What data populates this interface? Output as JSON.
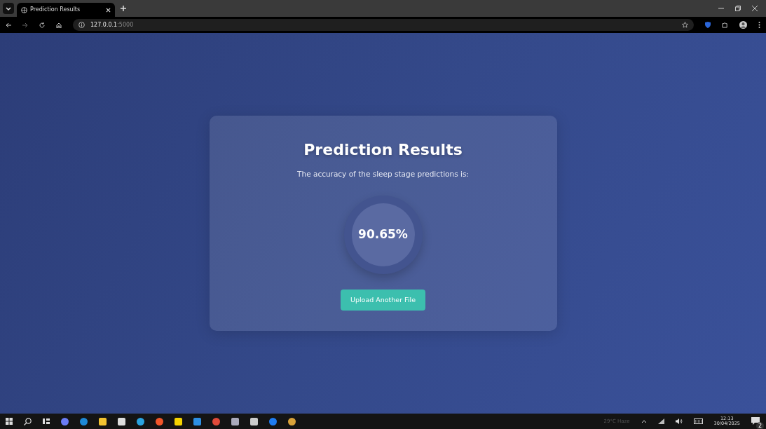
{
  "browser": {
    "tab_title": "Prediction Results",
    "address": {
      "host": "127.0.0.1",
      "port": ":5000"
    }
  },
  "card": {
    "title": "Prediction Results",
    "subtitle": "The accuracy of the sleep stage predictions is:",
    "accuracy": "90.65%",
    "button": "Upload Another File"
  },
  "taskbar": {
    "weather": "29°C Haze",
    "time": "12:13",
    "date": "30/04/2025",
    "notifications": "2"
  }
}
